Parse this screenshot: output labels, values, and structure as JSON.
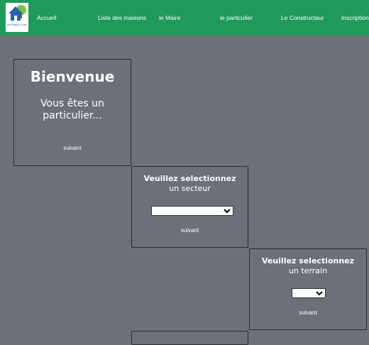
{
  "logo": {
    "text": "Ma Maison à coté"
  },
  "nav": {
    "items": [
      {
        "label": "Accueil"
      },
      {
        "label": "Liste des maisons"
      },
      {
        "label": "le Maire"
      },
      {
        "label": "le particulier"
      },
      {
        "label": "Le Constructeur"
      },
      {
        "label": "Inscription"
      }
    ]
  },
  "welcome": {
    "title": "Bienvenue",
    "subtitle_line1": "Vous êtes un",
    "subtitle_line2": "particulier...",
    "next_label": "suivant"
  },
  "sector": {
    "title_line1": "Veuillez selectionnez",
    "title_line2": "un secteur",
    "select_value": "",
    "next_label": "suivant"
  },
  "terrain": {
    "title_line1": "Veuillez selectionnez",
    "title_line2": "un terrain",
    "select_value": "",
    "next_label": "suivant"
  },
  "colors": {
    "navbar": "#1f9a5b",
    "background": "#6b7079",
    "card_border": "#2a2d33",
    "text": "#ffffff"
  }
}
